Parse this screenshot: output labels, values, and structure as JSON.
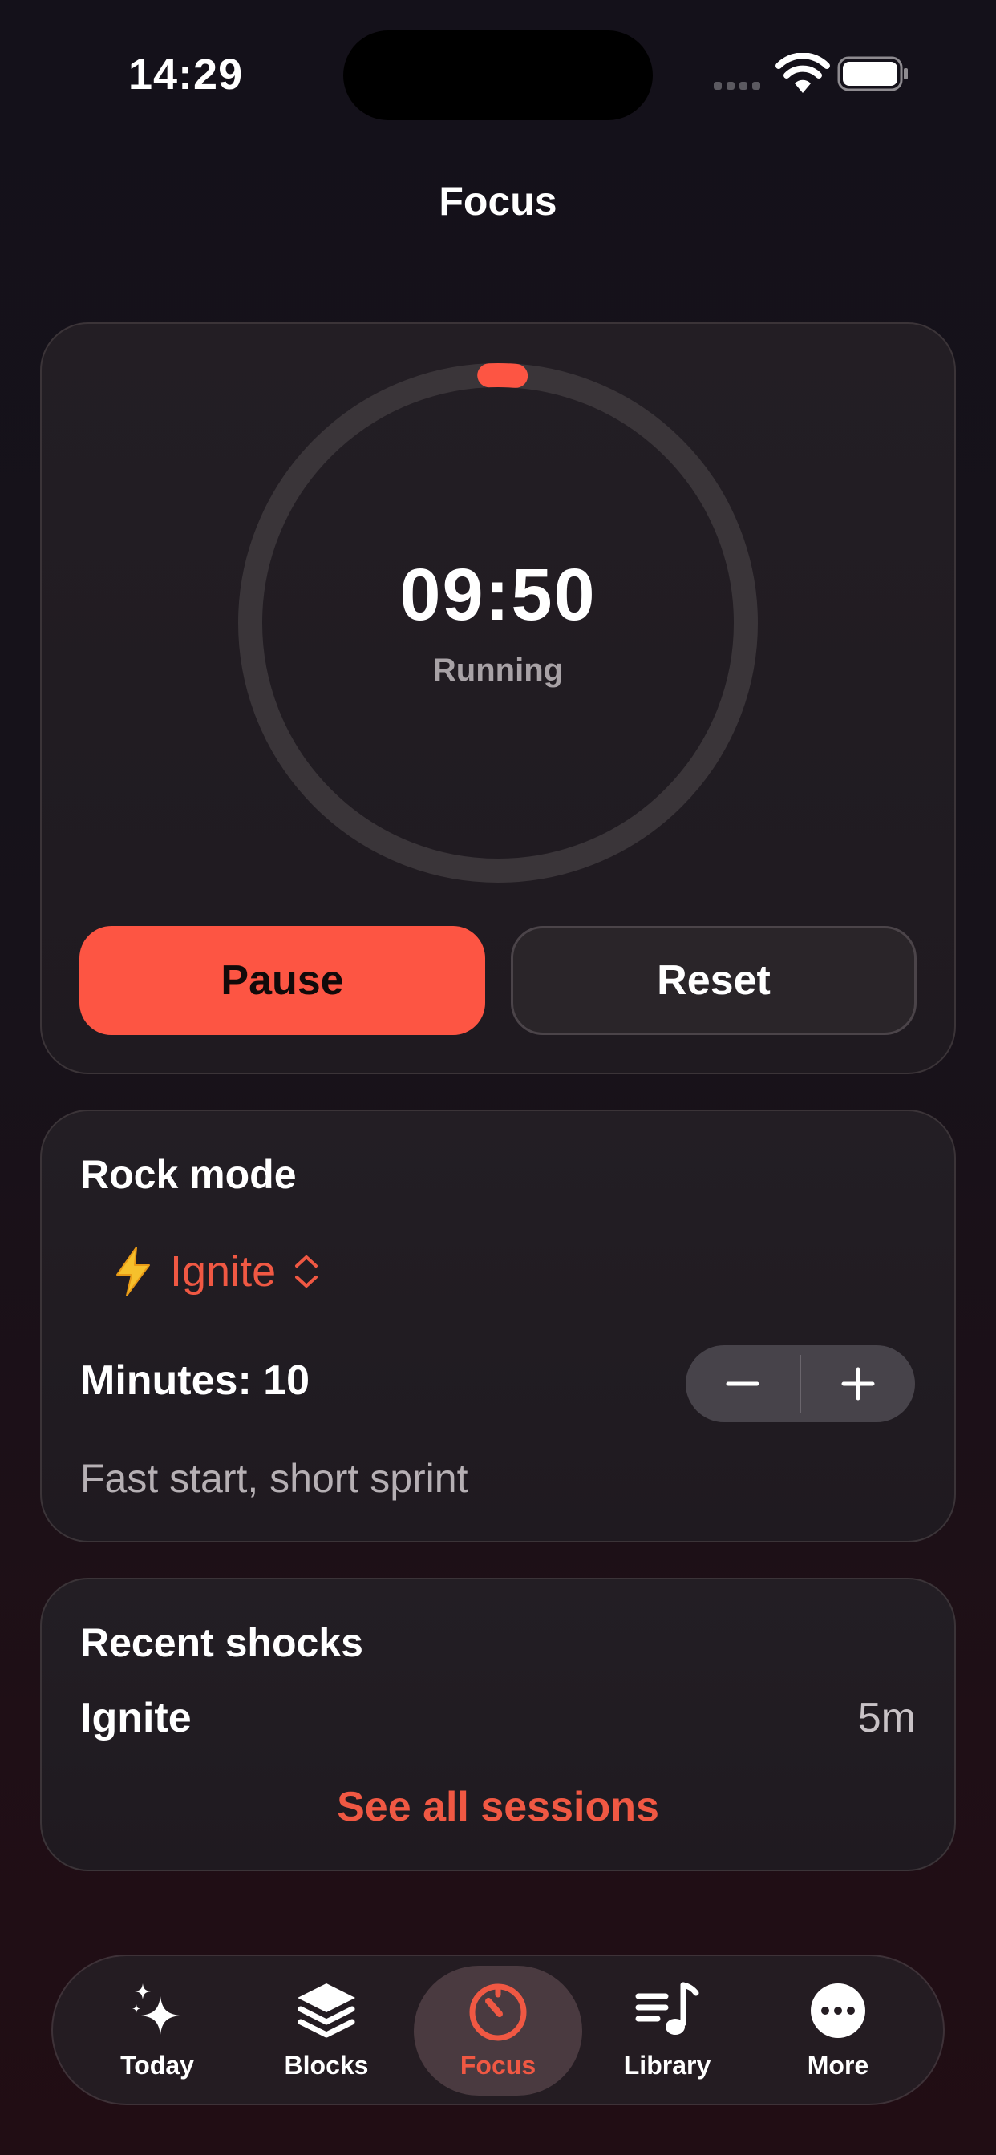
{
  "status_bar": {
    "time": "14:29"
  },
  "header": {
    "title": "Focus"
  },
  "timer": {
    "time_remaining": "09:50",
    "state": "Running",
    "progress": 0.017,
    "pause_label": "Pause",
    "reset_label": "Reset"
  },
  "rock_mode": {
    "title": "Rock mode",
    "selected_mode": "Ignite",
    "mode_icon": "lightning-bolt-icon",
    "minutes_label": "Minutes: 10",
    "description": "Fast start, short sprint"
  },
  "recent": {
    "title": "Recent shocks",
    "items": [
      {
        "name": "Ignite",
        "duration": "5m"
      }
    ],
    "see_all_label": "See all sessions"
  },
  "tabs": [
    {
      "label": "Today",
      "icon": "sparkles-icon"
    },
    {
      "label": "Blocks",
      "icon": "layers-icon"
    },
    {
      "label": "Focus",
      "icon": "timer-icon",
      "active": true
    },
    {
      "label": "Library",
      "icon": "music-list-icon"
    },
    {
      "label": "More",
      "icon": "more-icon"
    }
  ],
  "colors": {
    "accent": "#fd5543",
    "background": "#16121a",
    "card": "#221d23"
  }
}
